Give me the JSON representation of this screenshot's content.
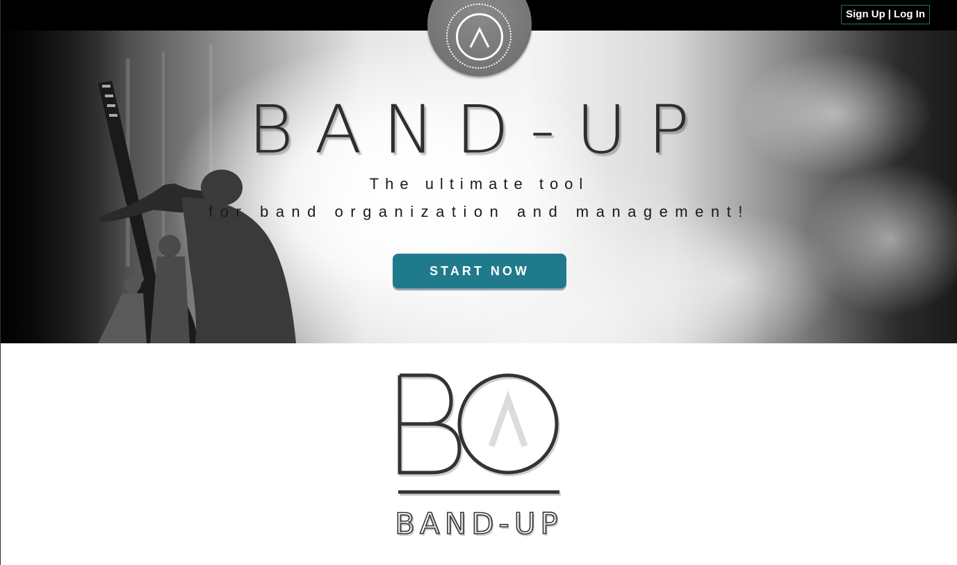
{
  "nav": {
    "sign_up": "Sign Up",
    "separator": "|",
    "log_in": "Log In"
  },
  "hero": {
    "title": "BAND-UP",
    "tagline_line1": "The ultimate tool",
    "tagline_line2": "for band organization and management!",
    "cta": "START NOW"
  },
  "logo": {
    "monogram_left": "B",
    "wordmark": "BAND-UP"
  },
  "colors": {
    "accent": "#1f7a8c",
    "nav_background": "#000000",
    "text_dark": "#2e2e2e"
  },
  "icons": {
    "badge": "caret-up-icon",
    "monogram_caret": "caret-up-icon"
  }
}
